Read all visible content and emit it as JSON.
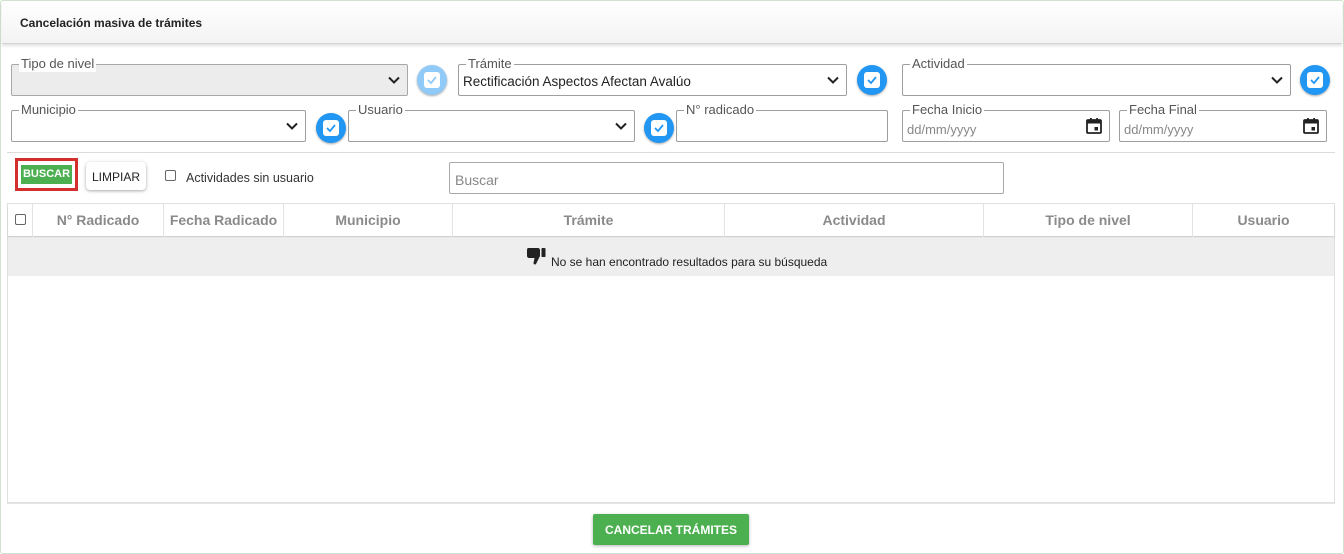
{
  "header": {
    "title": "Cancelación masiva de trámites"
  },
  "filters": {
    "tipo_nivel": {
      "label": "Tipo de nivel",
      "value": "",
      "disabled": true
    },
    "tramite": {
      "label": "Trámite",
      "value": "Rectificación Aspectos Afectan Avalúo"
    },
    "actividad": {
      "label": "Actividad",
      "value": ""
    },
    "municipio": {
      "label": "Municipio",
      "value": ""
    },
    "usuario": {
      "label": "Usuario",
      "value": ""
    },
    "radicado": {
      "label": "N° radicado",
      "value": ""
    },
    "fecha_inicio": {
      "label": "Fecha Inicio",
      "placeholder": "dd/mm/yyyy"
    },
    "fecha_final": {
      "label": "Fecha Final",
      "placeholder": "dd/mm/yyyy"
    }
  },
  "toolbar": {
    "buscar_label": "BUSCAR",
    "limpiar_label": "LIMPIAR",
    "sin_usuario_label": "Actividades sin usuario",
    "search_placeholder": "Buscar"
  },
  "table": {
    "columns": [
      "N° Radicado",
      "Fecha Radicado",
      "Municipio",
      "Trámite",
      "Actividad",
      "Tipo de nivel",
      "Usuario"
    ],
    "empty_message": "No se han encontrado resultados para su búsqueda"
  },
  "footer": {
    "cancelar_label": "CANCELAR TRÁMITES"
  },
  "colors": {
    "primary_green": "#4caf50",
    "check_blue": "#2196f3",
    "highlight_red": "#d32f2f"
  },
  "icons": {
    "select_toggle": "chevron-down-icon",
    "filter_enable": "checkbox-check-icon",
    "date_picker": "calendar-icon",
    "empty_state": "thumbs-down-icon"
  }
}
